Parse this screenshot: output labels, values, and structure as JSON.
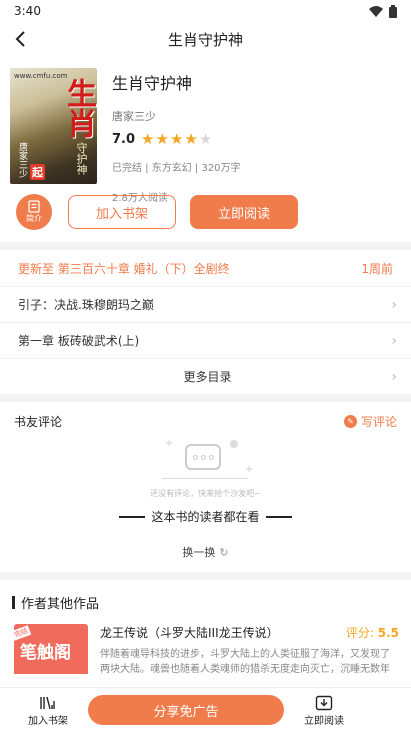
{
  "status_bar": {
    "time": "3:40"
  },
  "header": {
    "title": "生肖守护神"
  },
  "book": {
    "cover": {
      "big_text": "生肖",
      "small_text": "守护神",
      "url": "www.cmfu.com",
      "author_text": "唐家三少",
      "badge": "起"
    },
    "name": "生肖守护神",
    "author": "唐家三少",
    "score": "7.0",
    "rating_stars": 4,
    "meta": "已完结 | 东方玄幻 | 320万字",
    "reads": "2.8万人阅读"
  },
  "actions": {
    "intro": "简介",
    "add_shelf": "加入书架",
    "read_now": "立即阅读"
  },
  "chapters": {
    "update_text": "更新至 第三百六十章 婚礼（下）全剧终",
    "update_time": "1周前",
    "items": [
      "引子：决战.珠穆朗玛之巅",
      "第一章 板砖破武术(上)"
    ],
    "more": "更多目录"
  },
  "comments": {
    "title": "书友评论",
    "write": "写评论",
    "empty_text": "还没有评论，快来抢个沙发吧~",
    "readers_title": "这本书的读者都在看",
    "refresh": "换一换"
  },
  "works": {
    "title": "作者其他作品",
    "items": [
      {
        "cover_text": "笔触阁",
        "cover_tag": "完结",
        "title": "龙王传说（斗罗大陆III龙王传说）",
        "score_label": "评分:",
        "score": "5.5",
        "desc": "伴随着魂导科技的进步，斗罗大陆上的人类征服了海洋，又发现了两块大陆。魂兽也随着人类魂师的猎杀无度走向灭亡，沉睡无数年"
      }
    ]
  },
  "bottom_bar": {
    "add_shelf": "加入书架",
    "share": "分享免广告",
    "read_now": "立即阅读"
  },
  "colors": {
    "accent": "#f07b4b",
    "star": "#f5a623"
  }
}
